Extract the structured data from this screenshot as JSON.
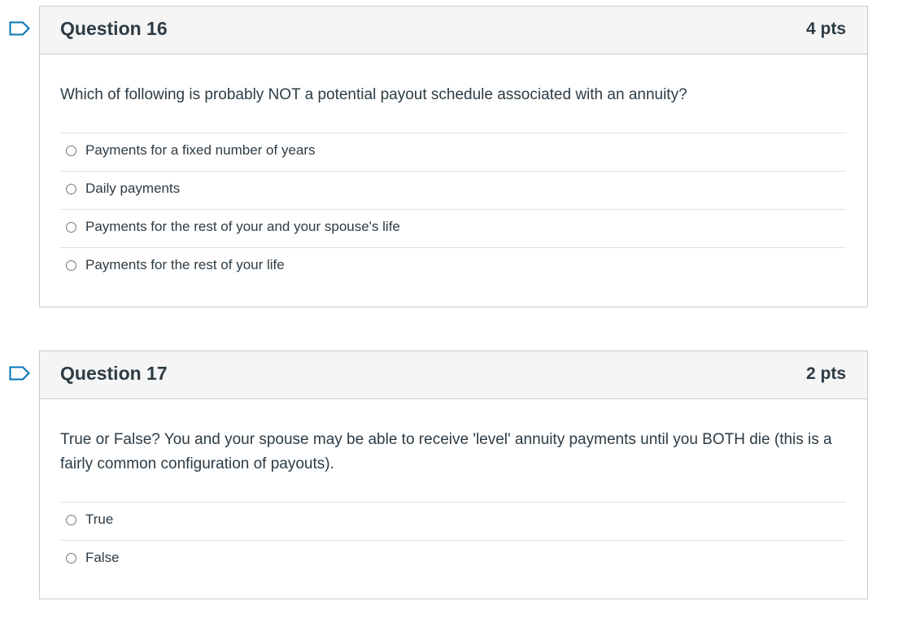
{
  "questions": [
    {
      "title": "Question 16",
      "points": "4 pts",
      "text": "Which of following is probably NOT a potential payout schedule associated with an annuity?",
      "answers": [
        "Payments for a fixed number of years",
        "Daily payments",
        "Payments for the rest of your and your spouse's life",
        "Payments for the rest of your life"
      ]
    },
    {
      "title": "Question 17",
      "points": "2 pts",
      "text": "True or False?  You and your spouse may be able to receive 'level' annuity payments until you BOTH die (this is a fairly common configuration of payouts).",
      "answers": [
        "True",
        "False"
      ]
    }
  ],
  "icons": {
    "flag": "bookmark-flag-icon",
    "radio": "radio-button-icon"
  },
  "colors": {
    "accent": "#0374b5",
    "text": "#2d3b45",
    "header_bg": "#f5f5f5",
    "border": "#c7cdd1"
  }
}
